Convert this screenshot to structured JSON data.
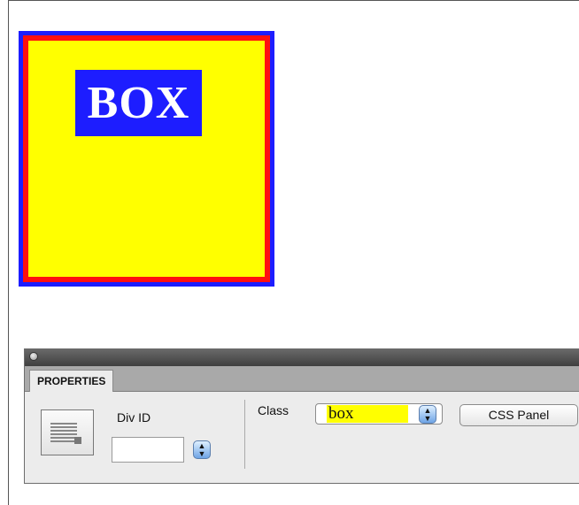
{
  "canvas": {
    "box_label": "BOX"
  },
  "panel": {
    "tab_label": "PROPERTIES",
    "div_id_label": "Div ID",
    "div_id_value": "",
    "class_label": "Class",
    "class_value": "box",
    "css_panel_label": "CSS Panel"
  },
  "icons": {
    "close": "close-dot-icon",
    "div_element": "div-element-icon",
    "stepper": "up-down-stepper-icon"
  },
  "colors": {
    "box_border_outer": "#1d1dff",
    "box_border_inner": "#ff1010",
    "box_fill": "#ffff00",
    "label_bg": "#1d1dff",
    "label_text": "#ffffff",
    "class_highlight": "#ffff00"
  }
}
